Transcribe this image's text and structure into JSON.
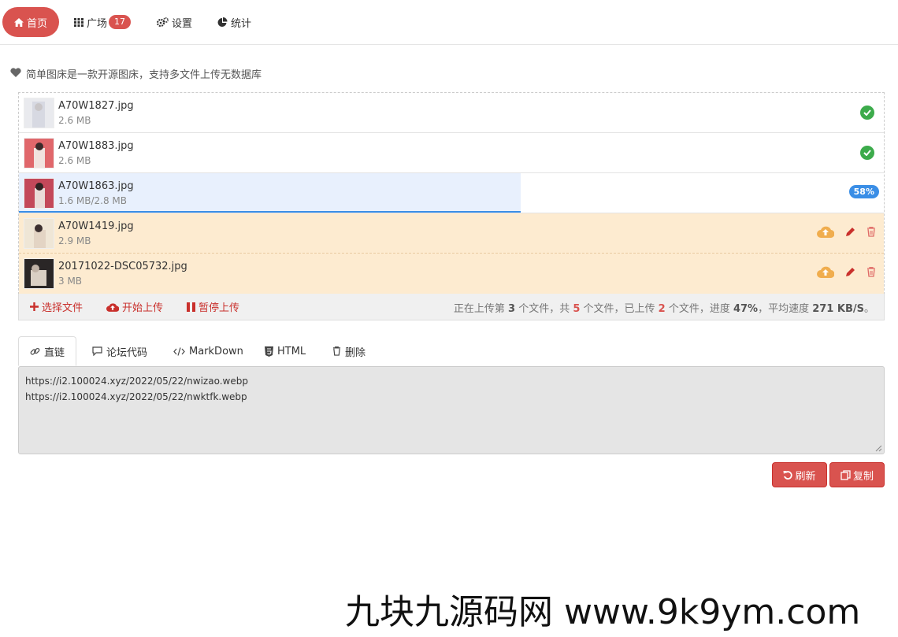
{
  "nav": {
    "home": "首页",
    "square": "广场",
    "square_badge": "17",
    "settings": "设置",
    "stats": "统计"
  },
  "intro": "简单图床是一款开源图床，支持多文件上传无数据库",
  "files": [
    {
      "name": "A70W1827.jpg",
      "size": "2.6 MB",
      "state": "done"
    },
    {
      "name": "A70W1883.jpg",
      "size": "2.6 MB",
      "state": "done"
    },
    {
      "name": "A70W1863.jpg",
      "size": "1.6 MB/2.8 MB",
      "state": "uploading",
      "progress_label": "58%",
      "progress": 0.58
    },
    {
      "name": "A70W1419.jpg",
      "size": "2.9 MB",
      "state": "queued"
    },
    {
      "name": "20171022-DSC05732.jpg",
      "size": "3 MB",
      "state": "queued"
    }
  ],
  "toolbar": {
    "select": "选择文件",
    "start": "开始上传",
    "pause": "暂停上传"
  },
  "status": {
    "p1": "正在上传第 ",
    "current": "3",
    "p2": " 个文件，共 ",
    "total": "5",
    "p3": " 个文件，已上传 ",
    "uploaded": "2",
    "p4": " 个文件，进度 ",
    "percent": "47%",
    "p5": "，平均速度 ",
    "speed": "271 KB/S",
    "p6": "。"
  },
  "tabs": [
    "直链",
    "论坛代码",
    "MarkDown",
    "HTML",
    "删除"
  ],
  "links": [
    "https://i2.100024.xyz/2022/05/22/nwizao.webp",
    "https://i2.100024.xyz/2022/05/22/nwktfk.webp"
  ],
  "buttons": {
    "refresh": "刷新",
    "copy": "复制"
  },
  "watermark": "九块九源码网 www.9k9ym.com",
  "colors": {
    "accent": "#d9534f",
    "success": "#3cab4b",
    "progress": "#3a8ee6",
    "queued_bg": "#fdebd0"
  }
}
